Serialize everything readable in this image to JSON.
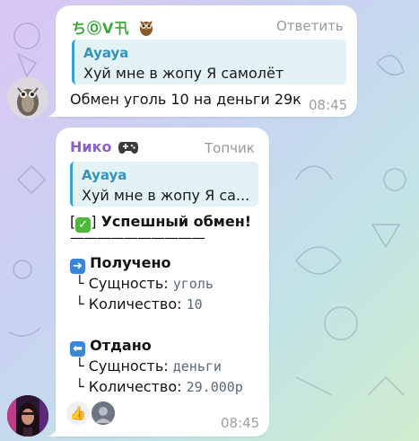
{
  "messages": [
    {
      "sender": "ちⓄⅤ卂",
      "sender_icon": "owl-icon",
      "action": "Ответить",
      "quote": {
        "author": "Ayaya",
        "text": "Хуй мне в жопу  Я самолёт"
      },
      "text": "Обмен уголь 10 на деньги 29к",
      "time": "08:45"
    },
    {
      "sender": "Нико",
      "sender_icon": "gamepad-icon",
      "role": "Топчик",
      "quote": {
        "author": "Ayaya",
        "text": "Хуй мне в жопу  Я са..."
      },
      "result": {
        "bracket_open": "[",
        "bracket_close": "]",
        "title": "Успешный обмен!",
        "divider": "——————————",
        "received_title": "Получено",
        "received_entity_label": "Сущность:",
        "received_entity_value": "уголь",
        "received_qty_label": "Количество:",
        "received_qty_value": "10",
        "given_title": "Отдано",
        "given_entity_label": "Сущность:",
        "given_entity_value": "деньги",
        "given_qty_label": "Количество:",
        "given_qty_value": "29.000р",
        "tree_glyph": "└"
      },
      "reactions": [
        "thumbs-up-icon",
        "reactor-avatar"
      ],
      "time": "08:45"
    }
  ],
  "colors": {
    "sender1": "#3aa63a",
    "sender2": "#8a60c8",
    "quote_accent": "#35a4cc",
    "bubble": "#ffffff"
  }
}
